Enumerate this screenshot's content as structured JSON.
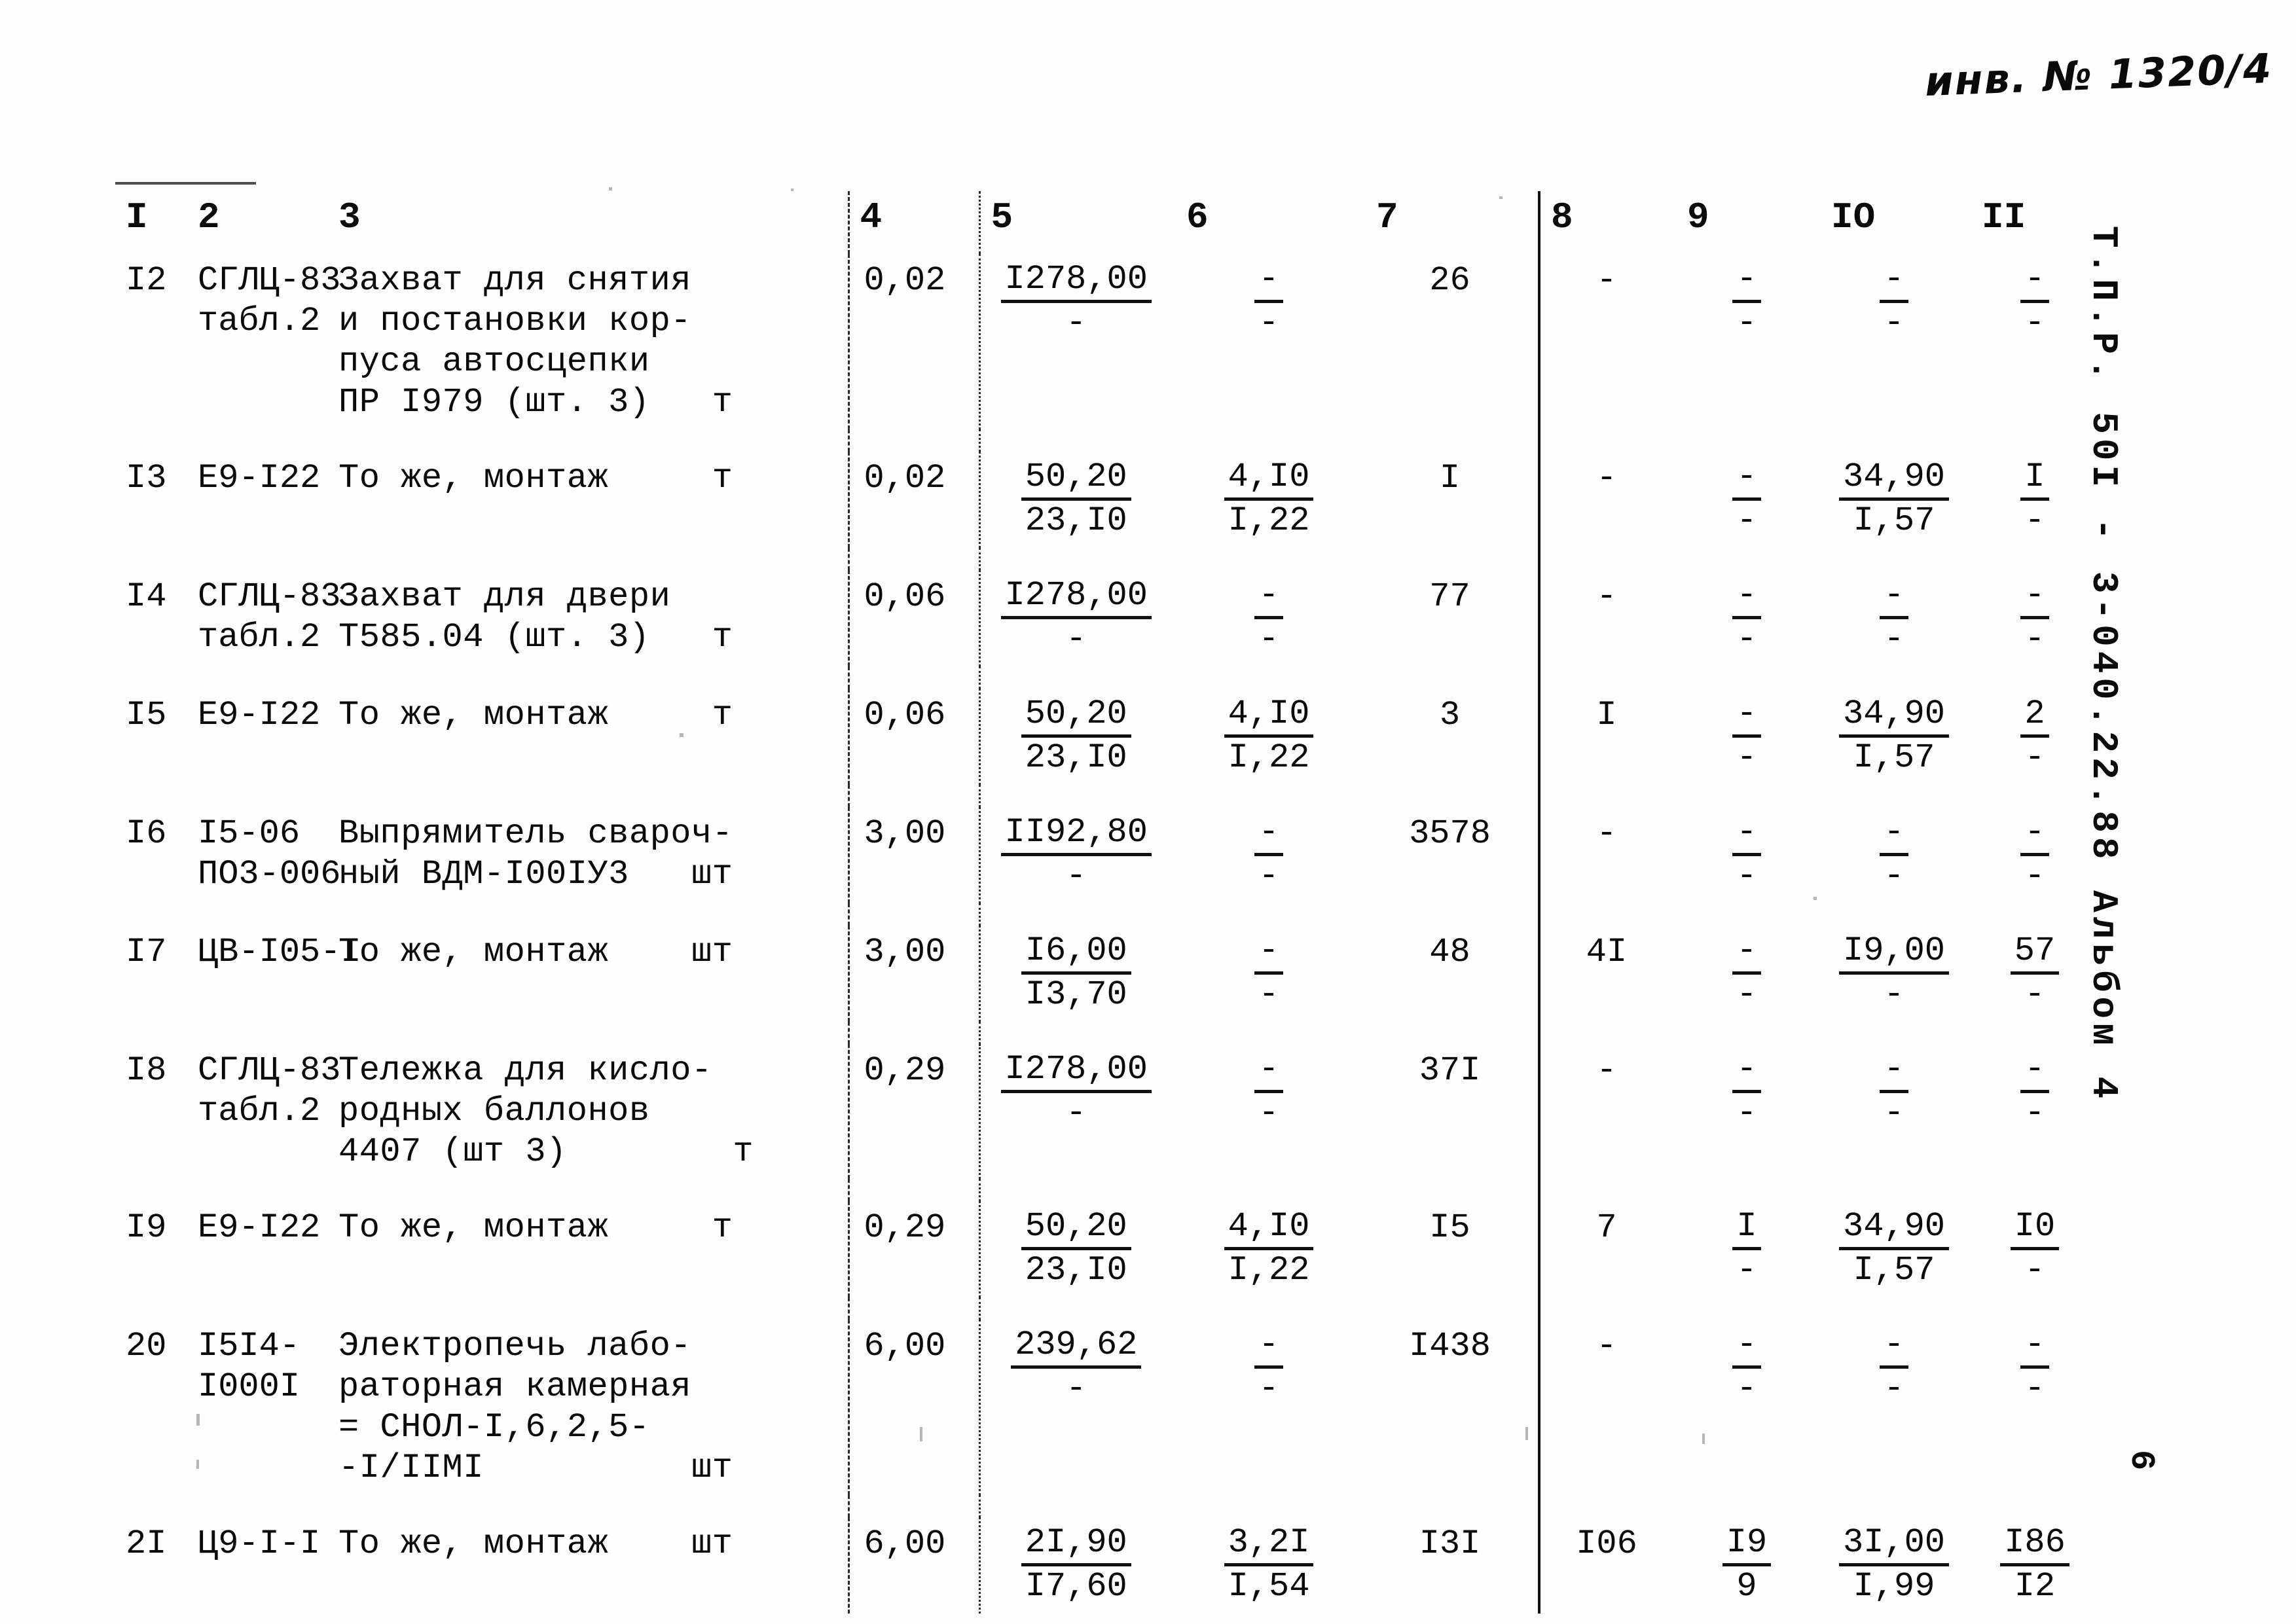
{
  "document": {
    "inventory_note": "инв. № 1320/4",
    "side_stamp": "Т.П.Р. 50I - 3-040.22.88 Альбом 4",
    "page_number": "6"
  },
  "table": {
    "headers": [
      "I",
      "2",
      "3",
      "4",
      "5",
      "6",
      "7",
      "8",
      "9",
      "IO",
      "II"
    ],
    "rows": [
      {
        "c1": "I2",
        "c2": "СГЛЦ-83\nтабл.2",
        "c3": "Захват для снятия\nи постановки кор-\nпуса автосцепки\nПР I979 (шт. 3)   т",
        "c4": "0,02",
        "c5_top": "I278,00",
        "c5_bot": "-",
        "c6_top": "-",
        "c6_bot": "-",
        "c7": "26",
        "c8": "-",
        "c9_top": "-",
        "c9_bot": "-",
        "c10_top": "-",
        "c10_bot": "-",
        "c11_top": "-",
        "c11_bot": "-"
      },
      {
        "c1": "I3",
        "c2": "Е9-I22",
        "c3": "То же, монтаж     т",
        "c4": "0,02",
        "c5_top": "50,20",
        "c5_bot": "23,I0",
        "c6_top": "4,I0",
        "c6_bot": "I,22",
        "c7": "I",
        "c8": "-",
        "c9_top": "-",
        "c9_bot": "-",
        "c10_top": "34,90",
        "c10_bot": "I,57",
        "c11_top": "I",
        "c11_bot": "-"
      },
      {
        "c1": "I4",
        "c2": "СГЛЦ-83\nтабл.2",
        "c3": "Захват для двери\nТ585.04 (шт. 3)   т",
        "c4": "0,06",
        "c5_top": "I278,00",
        "c5_bot": "-",
        "c6_top": "-",
        "c6_bot": "-",
        "c7": "77",
        "c8": "-",
        "c9_top": "-",
        "c9_bot": "-",
        "c10_top": "-",
        "c10_bot": "-",
        "c11_top": "-",
        "c11_bot": "-"
      },
      {
        "c1": "I5",
        "c2": "Е9-I22",
        "c3": "То же, монтаж     т",
        "c4": "0,06",
        "c5_top": "50,20",
        "c5_bot": "23,I0",
        "c6_top": "4,I0",
        "c6_bot": "I,22",
        "c7": "3",
        "c8": "I",
        "c9_top": "-",
        "c9_bot": "-",
        "c10_top": "34,90",
        "c10_bot": "I,57",
        "c11_top": "2",
        "c11_bot": "-"
      },
      {
        "c1": "I6",
        "c2": "I5-06\nПО3-006",
        "c3": "Выпрямитель свароч-\nный ВДМ-I00IУ3   шт",
        "c4": "3,00",
        "c5_top": "II92,80",
        "c5_bot": "-",
        "c6_top": "-",
        "c6_bot": "-",
        "c7": "3578",
        "c8": "-",
        "c9_top": "-",
        "c9_bot": "-",
        "c10_top": "-",
        "c10_bot": "-",
        "c11_top": "-",
        "c11_bot": "-"
      },
      {
        "c1": "I7",
        "c2": "ЦВ-I05-I",
        "c3": "То же, монтаж    шт",
        "c4": "3,00",
        "c5_top": "I6,00",
        "c5_bot": "I3,70",
        "c6_top": "-",
        "c6_bot": "-",
        "c7": "48",
        "c8": "4I",
        "c9_top": "-",
        "c9_bot": "-",
        "c10_top": "I9,00",
        "c10_bot": "-",
        "c11_top": "57",
        "c11_bot": "-"
      },
      {
        "c1": "I8",
        "c2": "СГЛЦ-83\nтабл.2",
        "c3": "Тележка для кисло-\nродных баллонов\n4407 (шт 3)        т",
        "c4": "0,29",
        "c5_top": "I278,00",
        "c5_bot": "-",
        "c6_top": "-",
        "c6_bot": "-",
        "c7": "37I",
        "c8": "-",
        "c9_top": "-",
        "c9_bot": "-",
        "c10_top": "-",
        "c10_bot": "-",
        "c11_top": "-",
        "c11_bot": "-"
      },
      {
        "c1": "I9",
        "c2": "Е9-I22",
        "c3": "То же, монтаж     т",
        "c4": "0,29",
        "c5_top": "50,20",
        "c5_bot": "23,I0",
        "c6_top": "4,I0",
        "c6_bot": "I,22",
        "c7": "I5",
        "c8": "7",
        "c9_top": "I",
        "c9_bot": "-",
        "c10_top": "34,90",
        "c10_bot": "I,57",
        "c11_top": "I0",
        "c11_bot": "-"
      },
      {
        "c1": "20",
        "c2": "I5I4-\nI000I",
        "c3": "Электропечь лабо-\nраторная камерная\n= СНОЛ-I,6,2,5-\n-I/IIMI          шт",
        "c4": "6,00",
        "c5_top": "239,62",
        "c5_bot": "-",
        "c6_top": "-",
        "c6_bot": "-",
        "c7": "I438",
        "c8": "-",
        "c9_top": "-",
        "c9_bot": "-",
        "c10_top": "-",
        "c10_bot": "-",
        "c11_top": "-",
        "c11_bot": "-"
      },
      {
        "c1": "2I",
        "c2": "Ц9-I-I",
        "c3": "То же, монтаж    шт",
        "c4": "6,00",
        "c5_top": "2I,90",
        "c5_bot": "I7,60",
        "c6_top": "3,2I",
        "c6_bot": "I,54",
        "c7": "I3I",
        "c8": "I06",
        "c9_top": "I9",
        "c9_bot": "9",
        "c10_top": "3I,00",
        "c10_bot": "I,99",
        "c11_top": "I86",
        "c11_bot": "I2"
      }
    ]
  }
}
